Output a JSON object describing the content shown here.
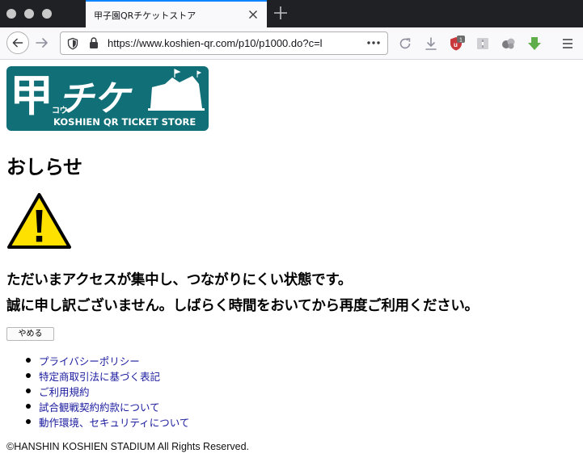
{
  "browser": {
    "tab_title": "甲子園QRチケットストア",
    "url": "https://www.koshien-qr.com/p10/p1000.do?c=l"
  },
  "logo": {
    "kanji": "甲",
    "kana": "チケ",
    "ruby": "コウ",
    "text": "KOSHIEN QR TICKET STORE",
    "bg_color": "#116f77"
  },
  "page": {
    "title": "おしらせ",
    "message_line1": "ただいまアクセスが集中し、つながりにくい状態です。",
    "message_line2": "誠に申し訳ございません。しばらく時間をおいてから再度ご利用ください。",
    "quit_button": "やめる",
    "warning_icon": "warning-triangle-icon",
    "links": [
      "プライバシーポリシー",
      "特定商取引法に基づく表記",
      "ご利用規約",
      "試合観戦契約約款について",
      "動作環境、セキュリティについて"
    ],
    "footer": "©HANSHIN KOSHIEN STADIUM All Rights Reserved.",
    "link_color": "#1a1a9f"
  },
  "toolbar": {
    "ublock_badge": "1"
  }
}
